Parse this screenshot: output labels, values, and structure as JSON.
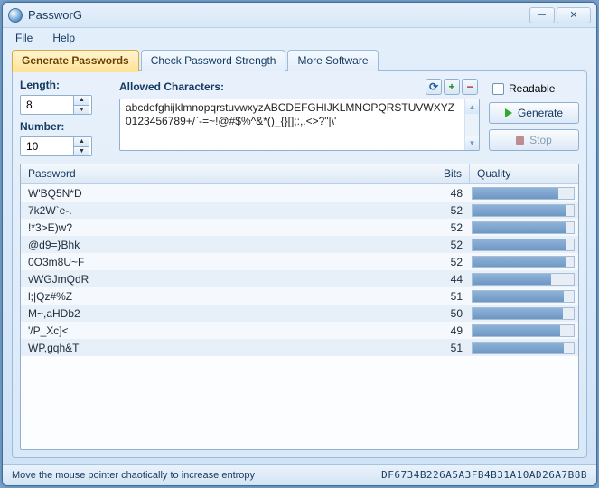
{
  "title": "PassworG",
  "menu": {
    "file": "File",
    "help": "Help"
  },
  "tabs": [
    {
      "label": "Generate Passwords",
      "active": true
    },
    {
      "label": "Check Password Strength",
      "active": false
    },
    {
      "label": "More Software",
      "active": false
    }
  ],
  "fields": {
    "length_label": "Length:",
    "length_value": "8",
    "number_label": "Number:",
    "number_value": "10",
    "allowed_label": "Allowed Characters:",
    "allowed_value": "abcdefghijklmnopqrstuvwxyzABCDEFGHIJKLMNOPQRSTUVWXYZ0123456789+/`-=~!@#$%^&*()_{}[];:,.<>?\"|\\'"
  },
  "icons": {
    "reset": "⟳",
    "add": "+",
    "remove": "−"
  },
  "options": {
    "readable_label": "Readable"
  },
  "buttons": {
    "generate": "Generate",
    "stop": "Stop"
  },
  "columns": {
    "password": "Password",
    "bits": "Bits",
    "quality": "Quality"
  },
  "results": [
    {
      "password": "W'BQ5N*D",
      "bits": 48,
      "quality_pct": 85
    },
    {
      "password": "7k2W`e-.",
      "bits": 52,
      "quality_pct": 92
    },
    {
      "password": "!*3>E)w?",
      "bits": 52,
      "quality_pct": 92
    },
    {
      "password": "@d9=}Bhk",
      "bits": 52,
      "quality_pct": 92
    },
    {
      "password": "0O3m8U~F",
      "bits": 52,
      "quality_pct": 92
    },
    {
      "password": "vWGJmQdR",
      "bits": 44,
      "quality_pct": 78
    },
    {
      "password": "l;|Qz#%Z",
      "bits": 51,
      "quality_pct": 90
    },
    {
      "password": "M~,aHDb2",
      "bits": 50,
      "quality_pct": 89
    },
    {
      "password": "'/P_Xc]<",
      "bits": 49,
      "quality_pct": 87
    },
    {
      "password": "WP,gqh&T",
      "bits": 51,
      "quality_pct": 90
    }
  ],
  "status": {
    "hint": "Move the mouse pointer chaotically to increase entropy",
    "hash": "DF6734B226A5A3FB4B31A10AD26A7B8B"
  }
}
